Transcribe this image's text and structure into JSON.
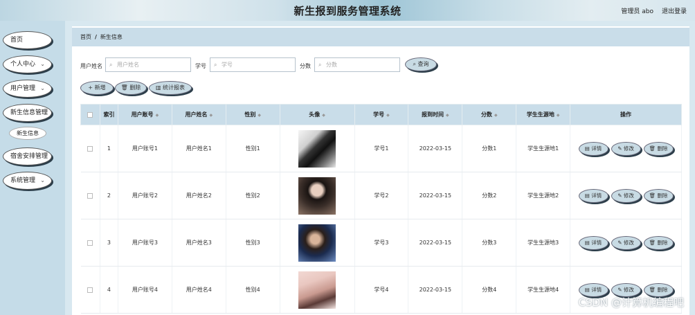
{
  "header": {
    "title": "新生报到服务管理系统",
    "admin": "管理员 abo",
    "logout": "退出登录"
  },
  "sidebar": {
    "items": [
      {
        "label": "首页",
        "has_children": false
      },
      {
        "label": "个人中心",
        "has_children": true
      },
      {
        "label": "用户管理",
        "has_children": true
      },
      {
        "label": "新生信息管理",
        "has_children": true
      },
      {
        "label": "宿舍安排管理",
        "has_children": true
      },
      {
        "label": "系统管理",
        "has_children": true
      }
    ],
    "active_sub": "新生信息"
  },
  "breadcrumb": {
    "home": "首页",
    "separator": "/",
    "current": "新生信息"
  },
  "search": {
    "username_label": "用户姓名",
    "username_placeholder": "用户姓名",
    "studentid_label": "学号",
    "studentid_placeholder": "学号",
    "score_label": "分数",
    "score_placeholder": "分数",
    "query_button": "查询"
  },
  "toolbar": {
    "add_label": "+ 新增",
    "delete_label": "删除",
    "stats_label": "统计报表"
  },
  "table": {
    "headers": [
      "索引",
      "用户账号",
      "用户姓名",
      "性别",
      "头像",
      "学号",
      "报到时间",
      "分数",
      "学生生源地",
      "操作"
    ],
    "rows": [
      {
        "index": "1",
        "account": "用户账号1",
        "name": "用户姓名1",
        "gender": "性别1",
        "studentid": "学号1",
        "date": "2022-03-15",
        "score": "分数1",
        "origin": "学生生源地1"
      },
      {
        "index": "2",
        "account": "用户账号2",
        "name": "用户姓名2",
        "gender": "性别2",
        "studentid": "学号2",
        "date": "2022-03-15",
        "score": "分数2",
        "origin": "学生生源地2"
      },
      {
        "index": "3",
        "account": "用户账号3",
        "name": "用户姓名3",
        "gender": "性别3",
        "studentid": "学号3",
        "date": "2022-03-15",
        "score": "分数3",
        "origin": "学生生源地3"
      },
      {
        "index": "4",
        "account": "用户账号4",
        "name": "用户姓名4",
        "gender": "性别4",
        "studentid": "学号4",
        "date": "2022-03-15",
        "score": "分数4",
        "origin": "学生生源地4"
      }
    ],
    "actions": {
      "detail": "详情",
      "edit": "修改",
      "delete": "删除"
    }
  },
  "watermark": "CSDN @计算机编程吧"
}
